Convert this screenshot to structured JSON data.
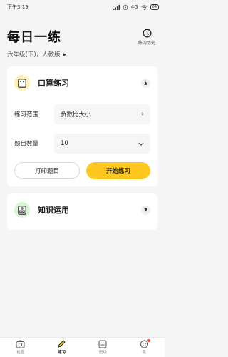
{
  "status_bar": {
    "time": "下午3:19",
    "network": "4G",
    "battery": "64"
  },
  "header": {
    "title": "每日一练",
    "grade": "六年级(下)，人教版",
    "history_label": "练习历史"
  },
  "practice_card": {
    "title": "口算练习",
    "range_label": "练习范围",
    "range_value": "负数比大小",
    "count_label": "题目数量",
    "count_value": "10",
    "print_label": "打印题目",
    "start_label": "开始练习"
  },
  "knowledge_card": {
    "title": "知识运用"
  },
  "tabbar": {
    "items": [
      {
        "label": "检查",
        "icon": "camera-icon"
      },
      {
        "label": "练习",
        "icon": "pencil-icon",
        "active": true
      },
      {
        "label": "班级",
        "icon": "class-icon"
      },
      {
        "label": "我",
        "icon": "profile-icon"
      }
    ]
  },
  "colors": {
    "accent": "#ffc820",
    "background": "#f5f5f5"
  }
}
